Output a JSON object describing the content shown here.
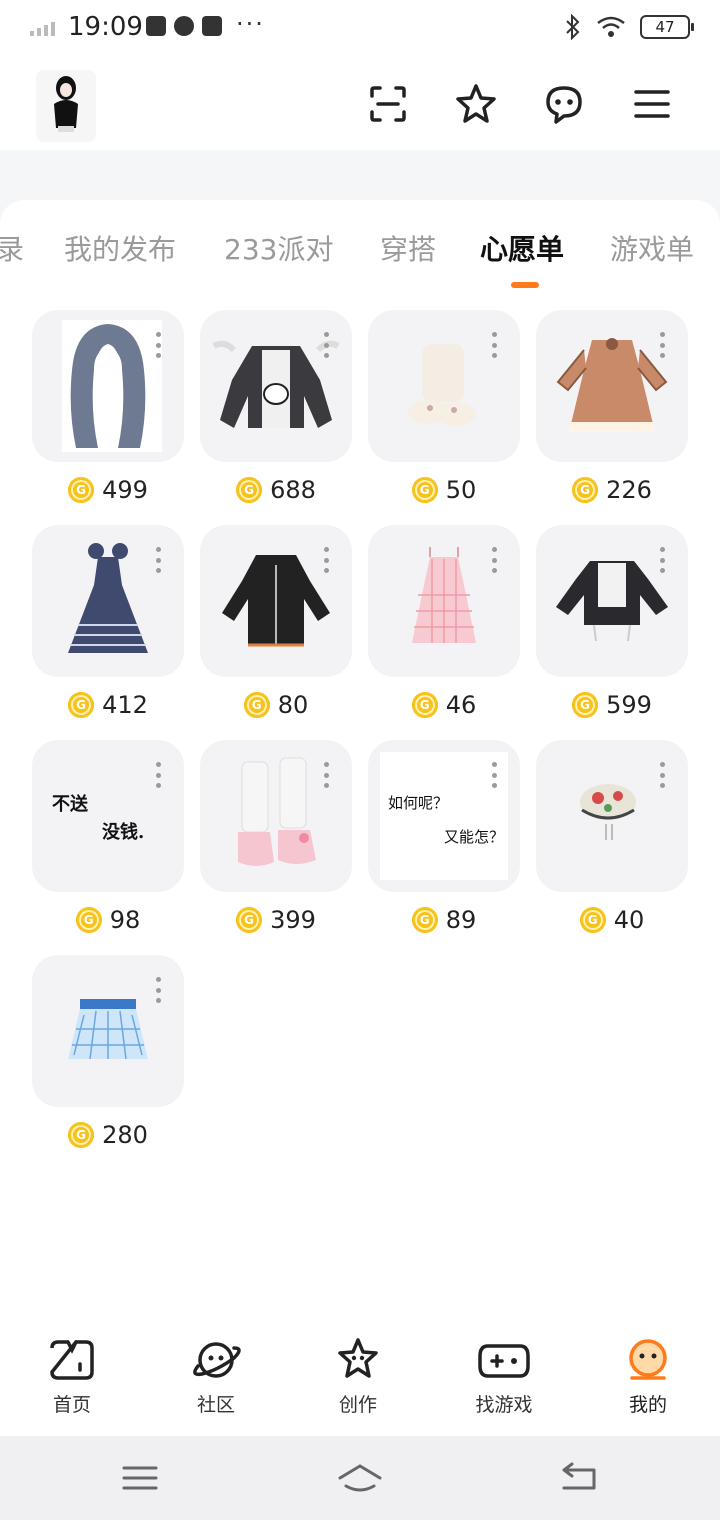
{
  "status": {
    "time": "19:09",
    "battery": "47"
  },
  "banner": {
    "text": ""
  },
  "tabs": [
    {
      "label": "录"
    },
    {
      "label": "我的发布"
    },
    {
      "label": "233派对"
    },
    {
      "label": "穿搭"
    },
    {
      "label": "心愿单"
    },
    {
      "label": "游戏单"
    }
  ],
  "active_tab": "心愿单",
  "wishlist": [
    {
      "name": "hair-item",
      "price": "499"
    },
    {
      "name": "bunny-top-item",
      "price": "688"
    },
    {
      "name": "socks-item",
      "price": "50"
    },
    {
      "name": "brown-dress-item",
      "price": "226"
    },
    {
      "name": "navy-gown-item",
      "price": "412"
    },
    {
      "name": "black-hoodie-item",
      "price": "80"
    },
    {
      "name": "pink-dress-item",
      "price": "46"
    },
    {
      "name": "maid-top-item",
      "price": "599"
    },
    {
      "name": "note-item-1",
      "price": "98",
      "note_lines": [
        "不送",
        "没钱."
      ]
    },
    {
      "name": "boots-item",
      "price": "399"
    },
    {
      "name": "note-item-2",
      "price": "89",
      "note_lines": [
        "如何呢？",
        "又能怎？"
      ]
    },
    {
      "name": "beret-item",
      "price": "40"
    },
    {
      "name": "plaid-skirt-item",
      "price": "280"
    }
  ],
  "bottom_nav": [
    {
      "label": "首页"
    },
    {
      "label": "社区"
    },
    {
      "label": "创作"
    },
    {
      "label": "找游戏"
    },
    {
      "label": "我的"
    }
  ],
  "colors": {
    "accent": "#ff7a1a",
    "coin": "#f6c21b",
    "banner": "#5fd0e6",
    "card_bg": "#f3f3f5"
  }
}
